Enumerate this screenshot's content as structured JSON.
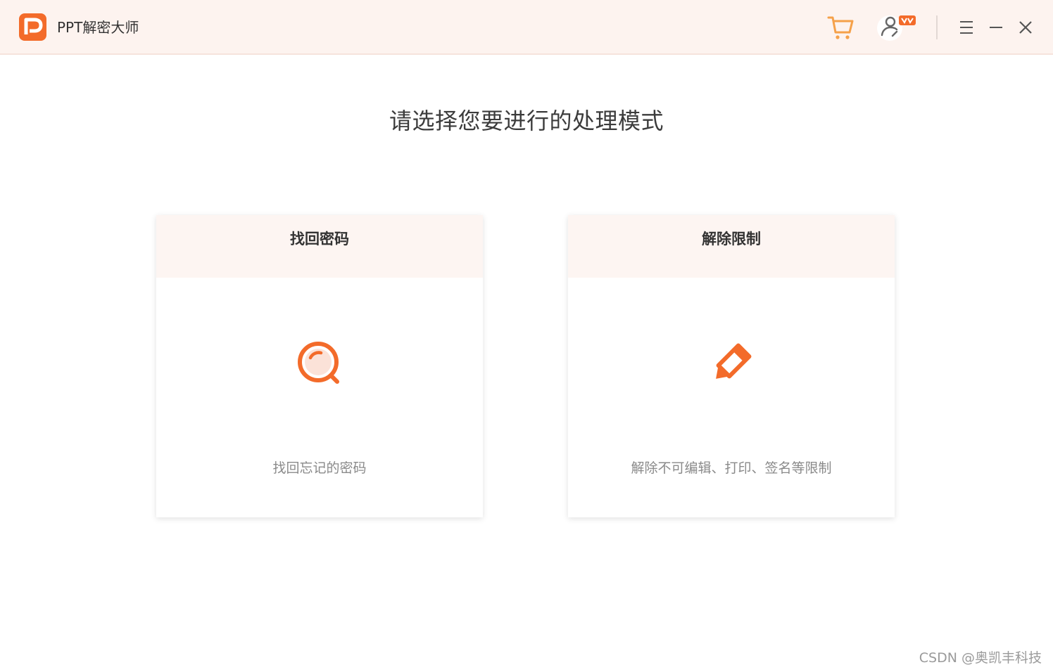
{
  "window": {
    "app_title": "PPT解密大师",
    "accent_color": "#f36b2a",
    "icons": {
      "logo": "p-logo-icon",
      "cart": "shopping-cart-icon",
      "user": "user-vip-icon",
      "menu": "menu-icon",
      "minimize": "minimize-icon",
      "close": "close-icon"
    }
  },
  "main": {
    "heading": "请选择您要进行的处理模式",
    "cards": [
      {
        "title": "找回密码",
        "description": "找回忘记的密码",
        "icon": "search-icon"
      },
      {
        "title": "解除限制",
        "description": "解除不可编辑、打印、签名等限制",
        "icon": "pencil-icon"
      }
    ]
  },
  "watermark": "CSDN @奥凯丰科技"
}
